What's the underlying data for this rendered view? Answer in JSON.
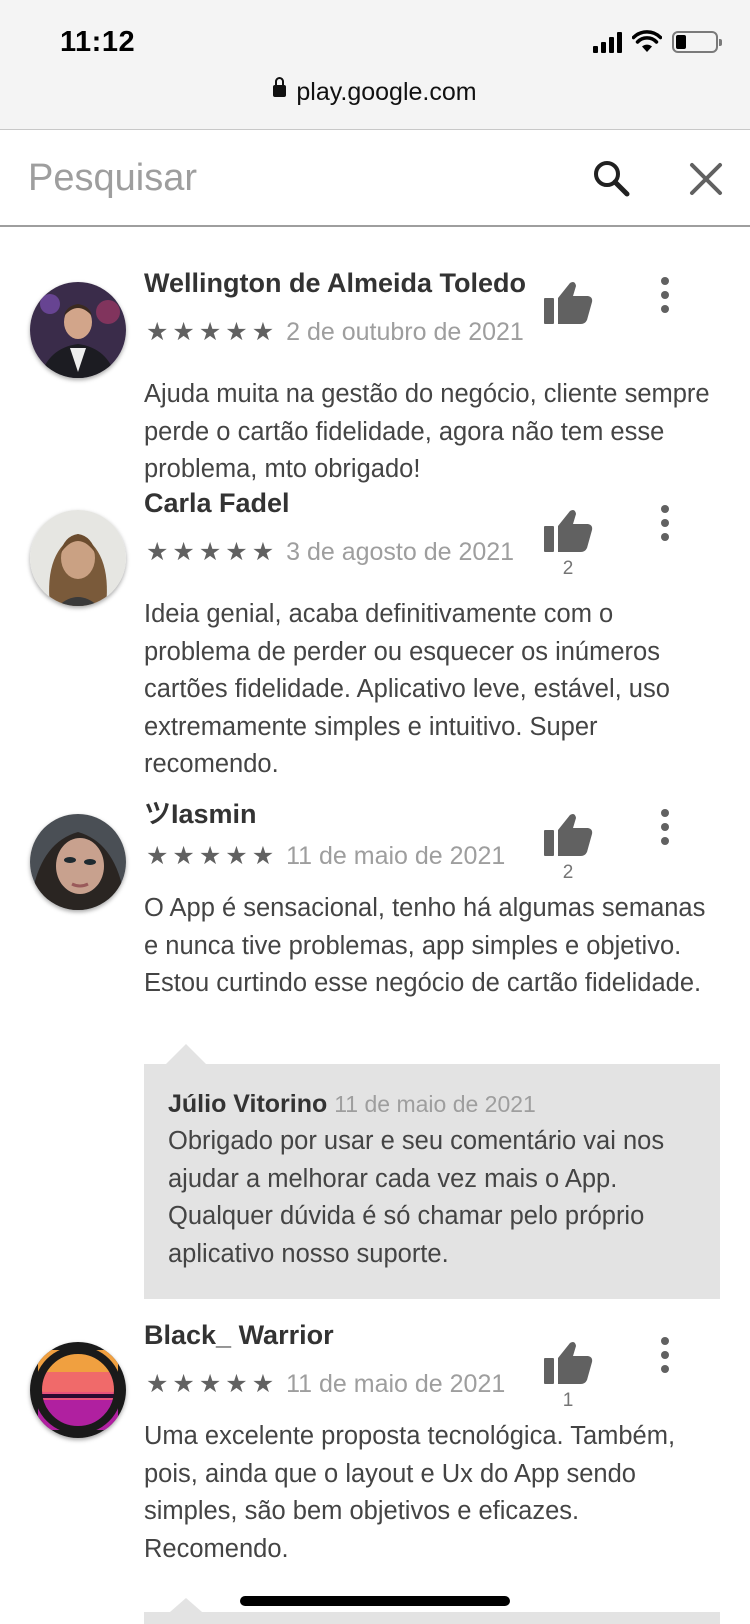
{
  "status_bar": {
    "time": "11:12",
    "battery_level": 0.25
  },
  "browser": {
    "url": "play.google.com"
  },
  "search": {
    "placeholder": "Pesquisar",
    "value": ""
  },
  "reviews": [
    {
      "author": "Wellington de Almeida Toledo",
      "rating": 5,
      "date": "2 de outubro de 2021",
      "helpful_count": "",
      "text": "Ajuda muita na gestão do negócio, cliente sempre perde o cartão fidelidade, agora não tem esse problema, mto obrigado!"
    },
    {
      "author": "Carla Fadel",
      "rating": 5,
      "date": "3 de agosto de 2021",
      "helpful_count": "2",
      "text": "Ideia genial, acaba definitivamente com o problema de perder ou esquecer os inúmeros cartões fidelidade. Aplicativo leve, estável, uso extremamente simples e intuitivo. Super recomendo."
    },
    {
      "author": "ツIasmin",
      "rating": 5,
      "date": "11 de maio de 2021",
      "helpful_count": "2",
      "text": "O App é sensacional, tenho há algumas semanas e nunca tive problemas, app simples e objetivo. Estou curtindo esse negócio de cartão fidelidade.",
      "reply": {
        "author": "Júlio Vitorino",
        "date": "11 de maio de 2021",
        "text": "Obrigado por usar e seu comentário vai nos ajudar a melhorar cada vez mais o App. Qualquer dúvida é só chamar pelo próprio aplicativo nosso suporte."
      }
    },
    {
      "author": "Black_ Warrior",
      "rating": 5,
      "date": "11 de maio de 2021",
      "helpful_count": "1",
      "text": "Uma excelente proposta tecnológica. Também, pois, ainda que o layout e Ux do App sendo simples, são bem objetivos e eficazes. Recomendo."
    }
  ],
  "stars": {
    "glyph": "★"
  },
  "colors": {
    "star": "#616161",
    "muted_text": "#9e9e9e",
    "reply_bg": "#e3e3e3"
  }
}
